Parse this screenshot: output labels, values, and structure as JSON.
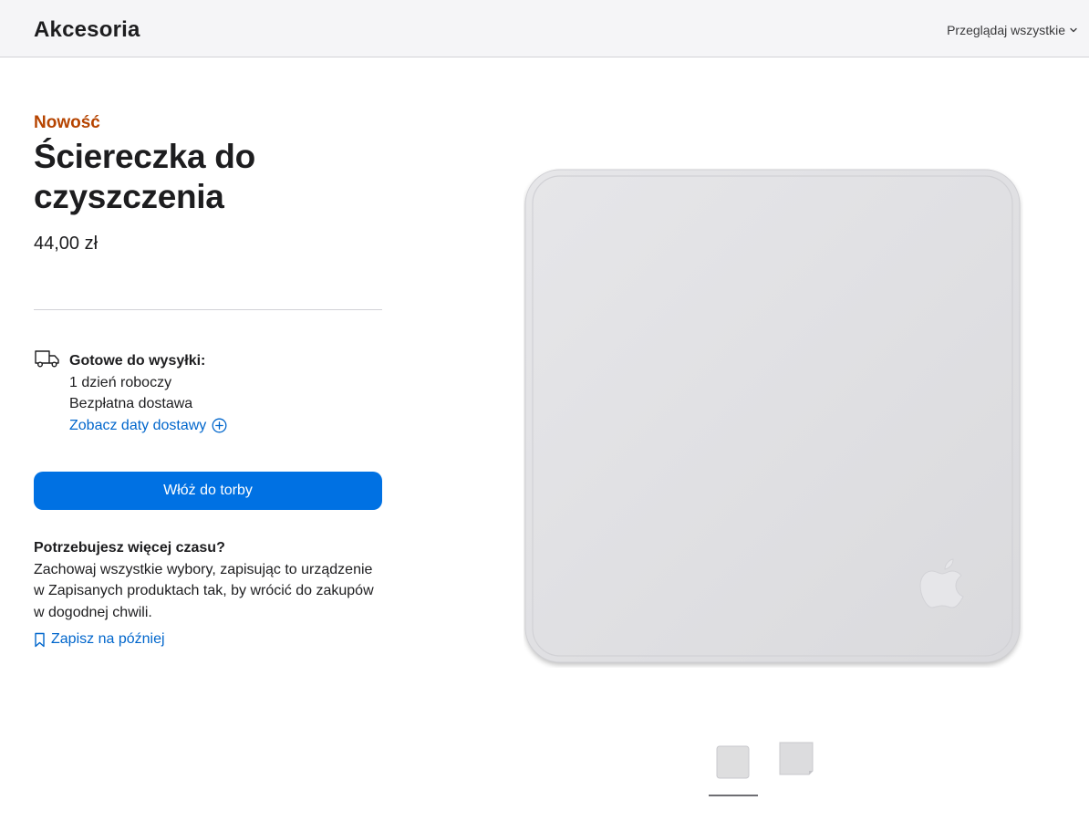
{
  "header": {
    "title": "Akcesoria",
    "browse_label": "Przeglądaj wszystkie"
  },
  "product": {
    "badge": "Nowość",
    "title": "Ściereczka do czyszczenia",
    "price": "44,00 zł"
  },
  "shipping": {
    "heading": "Gotowe do wysyłki:",
    "line1": "1 dzień roboczy",
    "line2": "Bezpłatna dostawa",
    "link": "Zobacz daty dostawy"
  },
  "actions": {
    "add_to_bag": "Włóż do torby"
  },
  "save": {
    "heading": "Potrzebujesz więcej czasu?",
    "body": "Zachowaj wszystkie wybory, zapisując to urządzenie w Zapisanych produktach tak, by wrócić do zakupów w dogodnej chwili.",
    "link": "Zapisz na później"
  },
  "gallery": {
    "selected_index": 0,
    "thumbnails": [
      "thumbnail-front",
      "thumbnail-angle"
    ]
  },
  "icons": {
    "browse": "chevron-down-icon",
    "shipping": "delivery-truck-icon",
    "delivery_dates": "plus-circle-icon",
    "save": "bookmark-icon",
    "hero_logo": "apple-logo"
  },
  "colors": {
    "accent_blue": "#0071e3",
    "link_blue": "#0066cc",
    "new_badge": "#b64400",
    "cloth": "#e3e3e6"
  }
}
